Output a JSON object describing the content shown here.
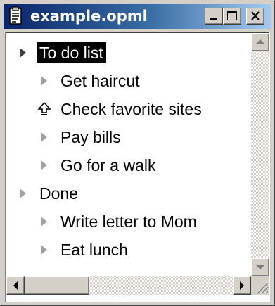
{
  "window": {
    "title": "example.opml",
    "icon": "document-icon",
    "controls": [
      "minimize-icon",
      "maximize-icon",
      "close-icon"
    ]
  },
  "outline": {
    "items": [
      {
        "text": "To do list",
        "level": 0,
        "icon": "triangle-right-icon",
        "selected": true
      },
      {
        "text": "Get haircut",
        "level": 1,
        "icon": "triangle-right-icon",
        "selected": false
      },
      {
        "text": "Check favorite sites",
        "level": 1,
        "icon": "up-arrow-icon",
        "selected": false
      },
      {
        "text": "Pay bills",
        "level": 1,
        "icon": "triangle-right-icon",
        "selected": false
      },
      {
        "text": "Go for a walk",
        "level": 1,
        "icon": "triangle-right-icon",
        "selected": false
      },
      {
        "text": "Done",
        "level": 0,
        "icon": "triangle-right-icon",
        "selected": false
      },
      {
        "text": "Write letter to Mom",
        "level": 1,
        "icon": "triangle-right-icon",
        "selected": false
      },
      {
        "text": "Eat lunch",
        "level": 1,
        "icon": "triangle-right-icon",
        "selected": false
      }
    ]
  },
  "colors": {
    "titlebar_start": "#0a246a",
    "titlebar_end": "#a6caf0",
    "selection": "#000000",
    "chrome": "#d4d0c8"
  }
}
